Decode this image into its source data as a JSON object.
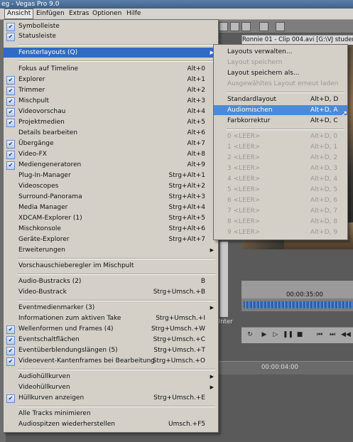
{
  "window": {
    "title": "eg - Vegas Pro 9.0"
  },
  "menubar": [
    {
      "label": "Ansicht",
      "active": true
    },
    {
      "label": "Einfügen"
    },
    {
      "label": "Extras"
    },
    {
      "label": "Optionen"
    },
    {
      "label": "Hilfe"
    }
  ],
  "clip_title": "Ronnie 01 - Clip 004.avi   [G:\\VJ students",
  "timeline": {
    "time_top": "00:00:35:00",
    "time_bottom": "00:00:04:00",
    "unter_label": "Unter"
  },
  "menu": {
    "items": [
      {
        "label": "Symbolleiste",
        "checked": true
      },
      {
        "label": "Statusleiste",
        "checked": true
      },
      {
        "label": "Fensterlayouts (Q)",
        "submenu": true,
        "highlight": true
      },
      {
        "label": "Fokus auf Timeline",
        "shortcut": "Alt+0"
      },
      {
        "label": "Explorer",
        "shortcut": "Alt+1",
        "checked": true
      },
      {
        "label": "Trimmer",
        "shortcut": "Alt+2",
        "checked": true
      },
      {
        "label": "Mischpult",
        "shortcut": "Alt+3",
        "checked": true
      },
      {
        "label": "Videovorschau",
        "shortcut": "Alt+4",
        "checked": true
      },
      {
        "label": "Projektmedien",
        "shortcut": "Alt+5",
        "checked": true
      },
      {
        "label": "Details bearbeiten",
        "shortcut": "Alt+6"
      },
      {
        "label": "Übergänge",
        "shortcut": "Alt+7",
        "checked": true
      },
      {
        "label": "Video-FX",
        "shortcut": "Alt+8",
        "checked": true
      },
      {
        "label": "Mediengeneratoren",
        "shortcut": "Alt+9",
        "checked": true
      },
      {
        "label": "Plug-In-Manager",
        "shortcut": "Strg+Alt+1"
      },
      {
        "label": "Videoscopes",
        "shortcut": "Strg+Alt+2"
      },
      {
        "label": "Surround-Panorama",
        "shortcut": "Strg+Alt+3"
      },
      {
        "label": "Media Manager",
        "shortcut": "Strg+Alt+4"
      },
      {
        "label": "XDCAM-Explorer (1)",
        "shortcut": "Strg+Alt+5"
      },
      {
        "label": "Mischkonsole",
        "shortcut": "Strg+Alt+6"
      },
      {
        "label": "Geräte-Explorer",
        "shortcut": "Strg+Alt+7"
      },
      {
        "label": "Erweiterungen",
        "submenu": true
      },
      {
        "label": "Vorschauschieberegler im Mischpult"
      },
      {
        "label": "Audio-Bustracks (2)",
        "shortcut": "B"
      },
      {
        "label": "Video-Bustrack",
        "shortcut": "Strg+Umsch.+B"
      },
      {
        "label": "Eventmedienmarker (3)",
        "submenu": true
      },
      {
        "label": "Informationen zum aktiven Take",
        "shortcut": "Strg+Umsch.+I"
      },
      {
        "label": "Wellenformen und Frames (4)",
        "shortcut": "Strg+Umsch.+W",
        "checked": true
      },
      {
        "label": "Eventschaltflächen",
        "shortcut": "Strg+Umsch.+C",
        "checked": true
      },
      {
        "label": "Eventüberblendungslängen (5)",
        "shortcut": "Strg+Umsch.+T",
        "checked": true
      },
      {
        "label": "Videoevent-Kantenframes bei Bearbeitung",
        "shortcut": "Strg+Umsch.+O",
        "checked": true
      },
      {
        "label": "Audiohüllkurven",
        "submenu": true
      },
      {
        "label": "Videohüllkurven",
        "submenu": true
      },
      {
        "label": "Hüllkurven anzeigen",
        "shortcut": "Strg+Umsch.+E",
        "checked": true
      },
      {
        "label": "Alle Tracks minimieren"
      },
      {
        "label": "Audiospitzen wiederherstellen",
        "shortcut": "Umsch.+F5"
      }
    ]
  },
  "submenu": {
    "items": [
      {
        "label": "Layouts verwalten..."
      },
      {
        "label": "Layout speichern",
        "disabled": true
      },
      {
        "label": "Layout speichern als..."
      },
      {
        "label": "Ausgewähltes Layout erneut laden",
        "disabled": true
      },
      {
        "label": "Standardlayout",
        "shortcut": "Alt+D, D"
      },
      {
        "label": "Audiomischen",
        "shortcut": "Alt+D, A",
        "highlight": true
      },
      {
        "label": "Farbkorrektur",
        "shortcut": "Alt+D, C"
      },
      {
        "label": "0 <LEER>",
        "shortcut": "Alt+D, 0",
        "disabled": true
      },
      {
        "label": "1 <LEER>",
        "shortcut": "Alt+D, 1",
        "disabled": true
      },
      {
        "label": "2 <LEER>",
        "shortcut": "Alt+D, 2",
        "disabled": true
      },
      {
        "label": "3 <LEER>",
        "shortcut": "Alt+D, 3",
        "disabled": true
      },
      {
        "label": "4 <LEER>",
        "shortcut": "Alt+D, 4",
        "disabled": true
      },
      {
        "label": "5 <LEER>",
        "shortcut": "Alt+D, 5",
        "disabled": true
      },
      {
        "label": "6 <LEER>",
        "shortcut": "Alt+D, 6",
        "disabled": true
      },
      {
        "label": "7 <LEER>",
        "shortcut": "Alt+D, 7",
        "disabled": true
      },
      {
        "label": "8 <LEER>",
        "shortcut": "Alt+D, 8",
        "disabled": true
      },
      {
        "label": "9 <LEER>",
        "shortcut": "Alt+D, 9",
        "disabled": true
      }
    ]
  }
}
